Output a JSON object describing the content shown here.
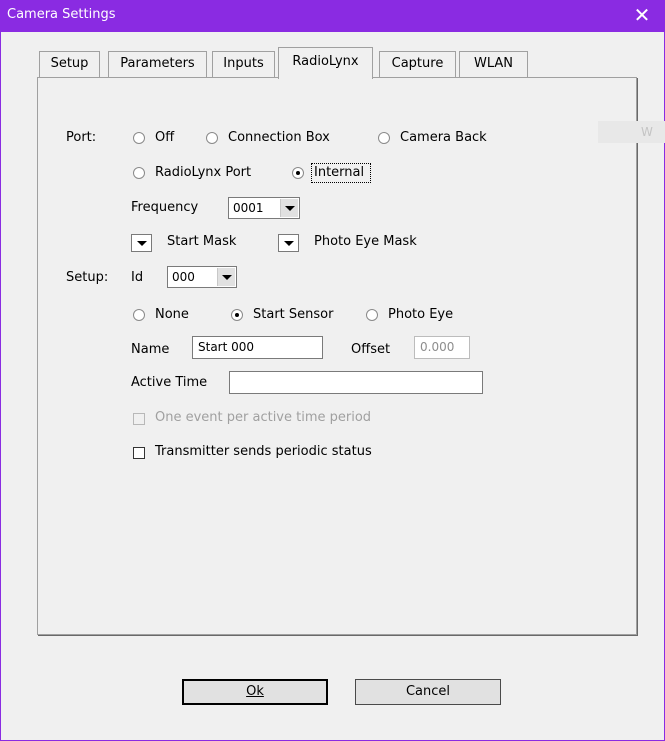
{
  "window": {
    "title": "Camera Settings",
    "close_glyph": "✕"
  },
  "tabs": [
    {
      "label": "Setup"
    },
    {
      "label": "Parameters"
    },
    {
      "label": "Inputs"
    },
    {
      "label": "RadioLynx",
      "selected": true
    },
    {
      "label": "Capture"
    },
    {
      "label": "WLAN"
    }
  ],
  "port": {
    "label": "Port:",
    "options": [
      "Off",
      "Connection Box",
      "Camera Back",
      "RadioLynx Port",
      "Internal"
    ],
    "selected": "Internal"
  },
  "frequency": {
    "label": "Frequency",
    "value": "0001"
  },
  "masks": {
    "start_mask_label": "Start Mask",
    "photo_eye_mask_label": "Photo Eye Mask"
  },
  "setup": {
    "label": "Setup:",
    "id_label": "Id",
    "id_value": "000",
    "sensor_options": [
      "None",
      "Start Sensor",
      "Photo Eye"
    ],
    "sensor_selected": "Start Sensor",
    "name_label": "Name",
    "name_value": "Start 000",
    "offset_label": "Offset",
    "offset_value": "0.000",
    "active_time_label": "Active Time",
    "active_time_value": "",
    "one_event_label": "One event per active time period",
    "one_event_checked": false,
    "one_event_enabled": false,
    "periodic_status_label": "Transmitter sends periodic status",
    "periodic_status_checked": false
  },
  "buttons": {
    "ok": "Ok",
    "cancel": "Cancel"
  },
  "background_fragment": "W",
  "colors": {
    "titlebar": "#8a2be2",
    "dialog_bg": "#f0f0f0"
  }
}
